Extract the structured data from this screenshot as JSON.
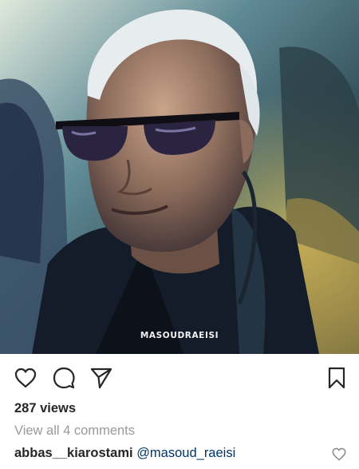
{
  "post": {
    "watermark": "MASOUDRAEISI",
    "views": "287 views",
    "comments_link": "View all 4 comments",
    "caption_user": "abbas__kiarostami",
    "caption_mention": "@masoud_raeisi"
  },
  "icons": {
    "like": "heart-icon",
    "comment": "comment-bubble-icon",
    "share": "paper-plane-icon",
    "save": "bookmark-icon",
    "caption_like": "small-heart-icon"
  },
  "colors": {
    "text": "#262626",
    "muted": "#999999",
    "mention": "#003569"
  }
}
